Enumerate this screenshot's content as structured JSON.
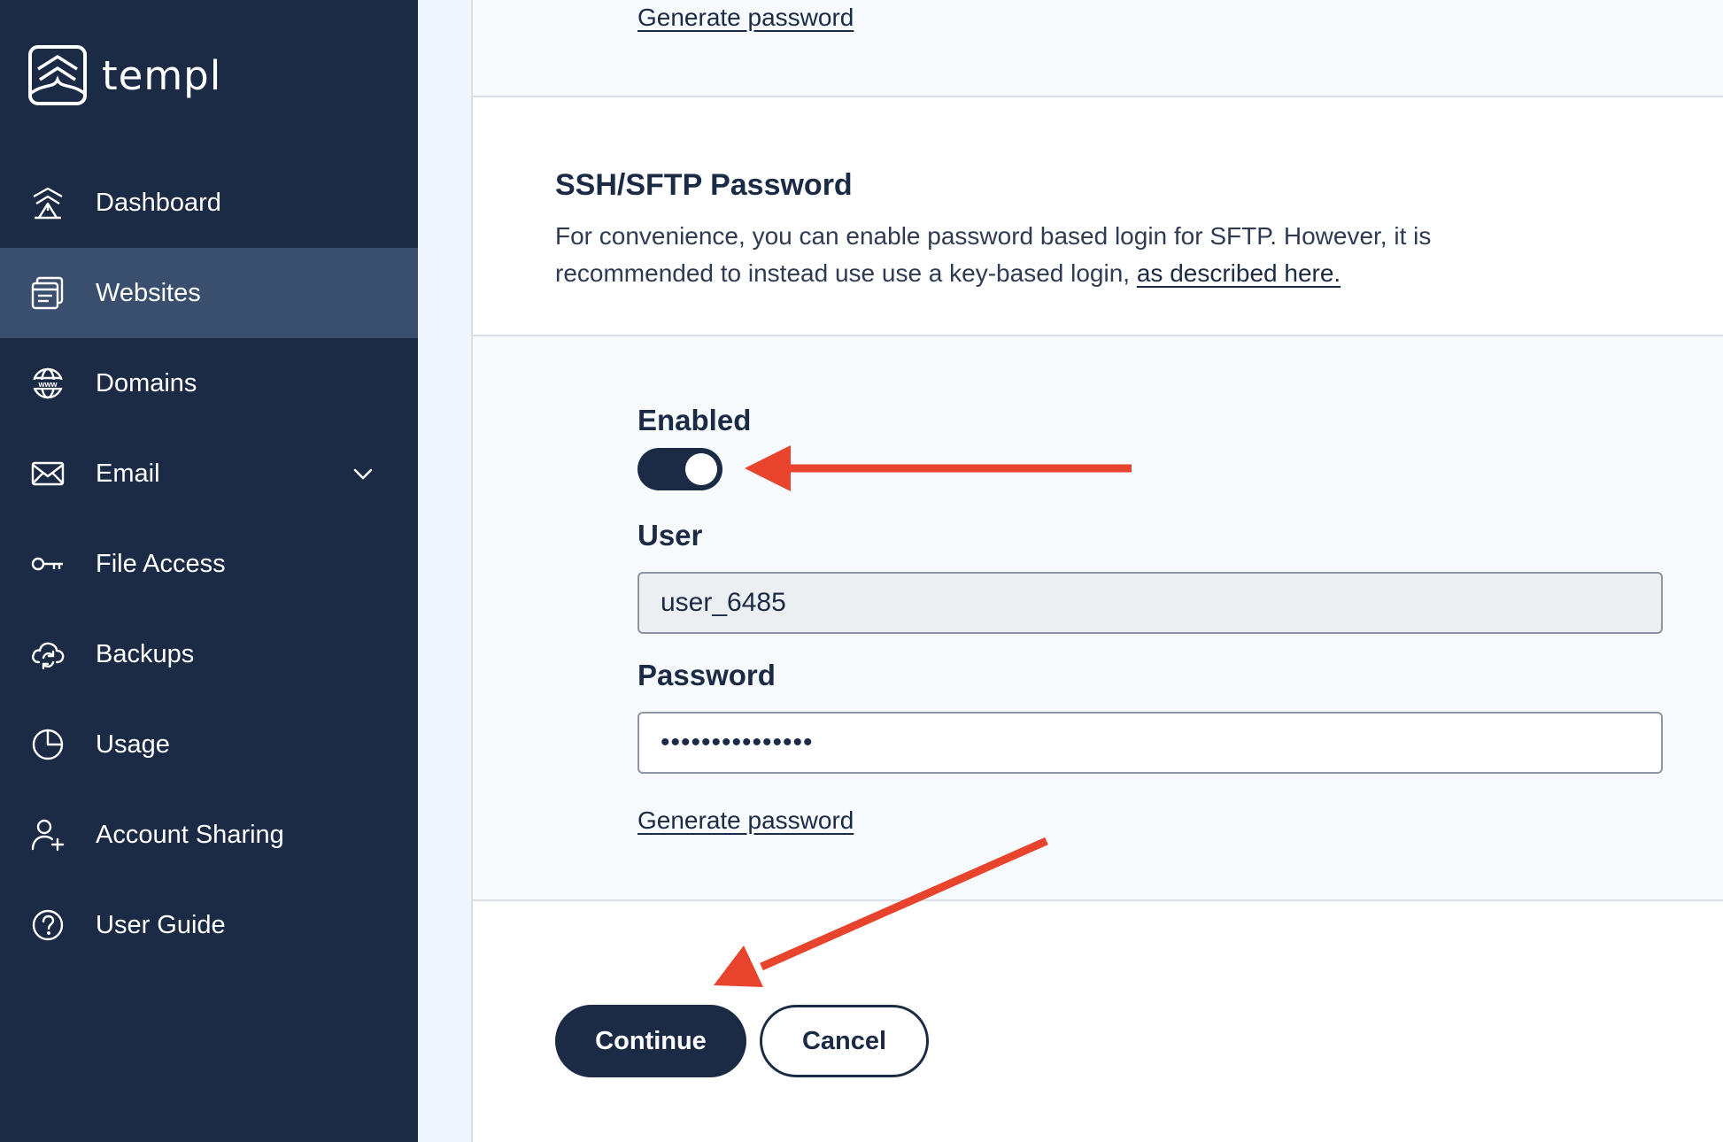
{
  "brand": {
    "name": "templ"
  },
  "sidebar": {
    "items": [
      {
        "label": "Dashboard",
        "icon": "dashboard-icon",
        "active": false
      },
      {
        "label": "Websites",
        "icon": "websites-icon",
        "active": true
      },
      {
        "label": "Domains",
        "icon": "globe-icon",
        "active": false
      },
      {
        "label": "Email",
        "icon": "envelope-icon",
        "active": false,
        "expandable": true
      },
      {
        "label": "File Access",
        "icon": "key-icon",
        "active": false
      },
      {
        "label": "Backups",
        "icon": "cloud-sync-icon",
        "active": false
      },
      {
        "label": "Usage",
        "icon": "pie-chart-icon",
        "active": false
      },
      {
        "label": "Account Sharing",
        "icon": "user-plus-icon",
        "active": false
      },
      {
        "label": "User Guide",
        "icon": "help-circle-icon",
        "active": false
      }
    ]
  },
  "top_section": {
    "generate_link": "Generate password"
  },
  "ssh": {
    "title": "SSH/SFTP Password",
    "description": "For convenience, you can enable password based login for SFTP. However, it is recommended to instead use use a key-based login, ",
    "description_link": "as described here."
  },
  "form": {
    "enabled_label": "Enabled",
    "enabled": true,
    "user_label": "User",
    "user_value": "user_6485",
    "password_label": "Password",
    "password_value": "•••••••••••••••",
    "generate_link": "Generate password"
  },
  "actions": {
    "continue_label": "Continue",
    "cancel_label": "Cancel"
  },
  "colors": {
    "sidebar": "#1b2a45",
    "active_item": "#3a4f6d",
    "annotation": "#e8432d"
  }
}
